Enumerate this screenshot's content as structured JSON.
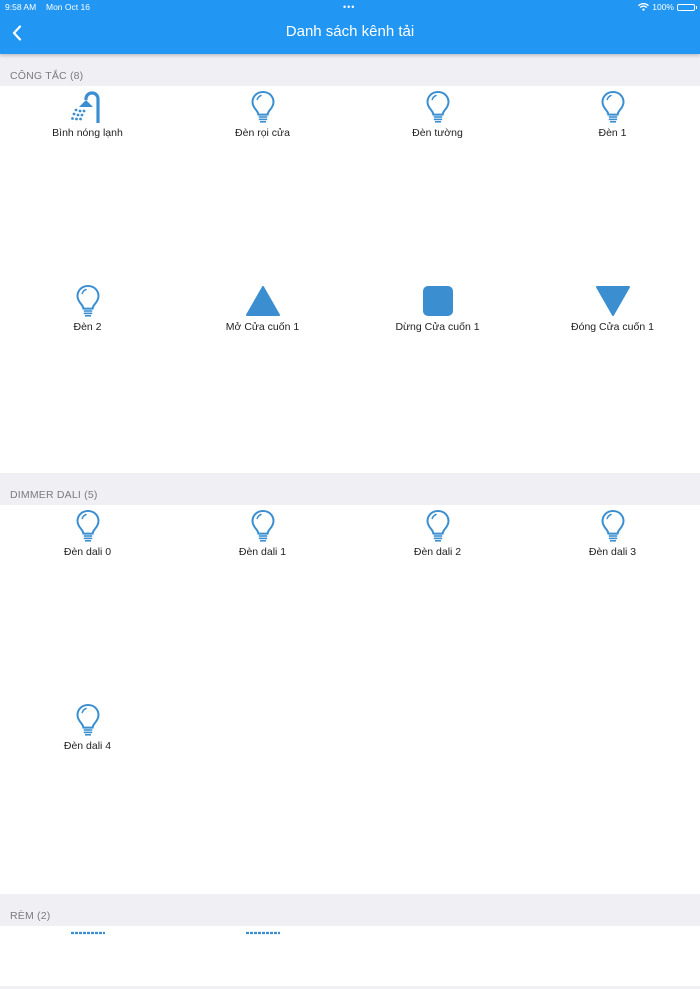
{
  "status_bar": {
    "time": "9:58 AM",
    "date": "Mon Oct 16",
    "dots": "•••",
    "battery": "100%"
  },
  "header": {
    "title": "Danh sách kênh tải",
    "back_icon": "chevron-left-icon"
  },
  "colors": {
    "accent": "#2196f3",
    "icon": "#3b8fd1",
    "background": "#efeff4"
  },
  "sections": [
    {
      "title": "CÔNG TẮC (8)",
      "items": [
        {
          "label": "Bình nóng lạnh",
          "icon": "shower-icon"
        },
        {
          "label": "Đèn rọi cửa",
          "icon": "light-bulb-icon"
        },
        {
          "label": "Đèn tường",
          "icon": "light-bulb-icon"
        },
        {
          "label": "Đèn 1",
          "icon": "light-bulb-icon"
        },
        {
          "label": "Đèn 2",
          "icon": "light-bulb-icon"
        },
        {
          "label": "Mở Cửa cuốn 1",
          "icon": "triangle-up-icon"
        },
        {
          "label": "Dừng Cửa cuốn 1",
          "icon": "stop-square-icon"
        },
        {
          "label": "Đóng Cửa cuốn 1",
          "icon": "triangle-down-icon"
        }
      ]
    },
    {
      "title": "DIMMER DALI (5)",
      "items": [
        {
          "label": "Đèn dali 0",
          "icon": "light-bulb-icon"
        },
        {
          "label": "Đèn dali 1",
          "icon": "light-bulb-icon"
        },
        {
          "label": "Đèn dali 2",
          "icon": "light-bulb-icon"
        },
        {
          "label": "Đèn dali 3",
          "icon": "light-bulb-icon"
        },
        {
          "label": "Đèn dali 4",
          "icon": "light-bulb-icon"
        }
      ]
    },
    {
      "title": "RÈM (2)",
      "items": [
        {
          "label": "",
          "icon": "curtain-icon"
        },
        {
          "label": "",
          "icon": "curtain-icon"
        }
      ]
    }
  ]
}
